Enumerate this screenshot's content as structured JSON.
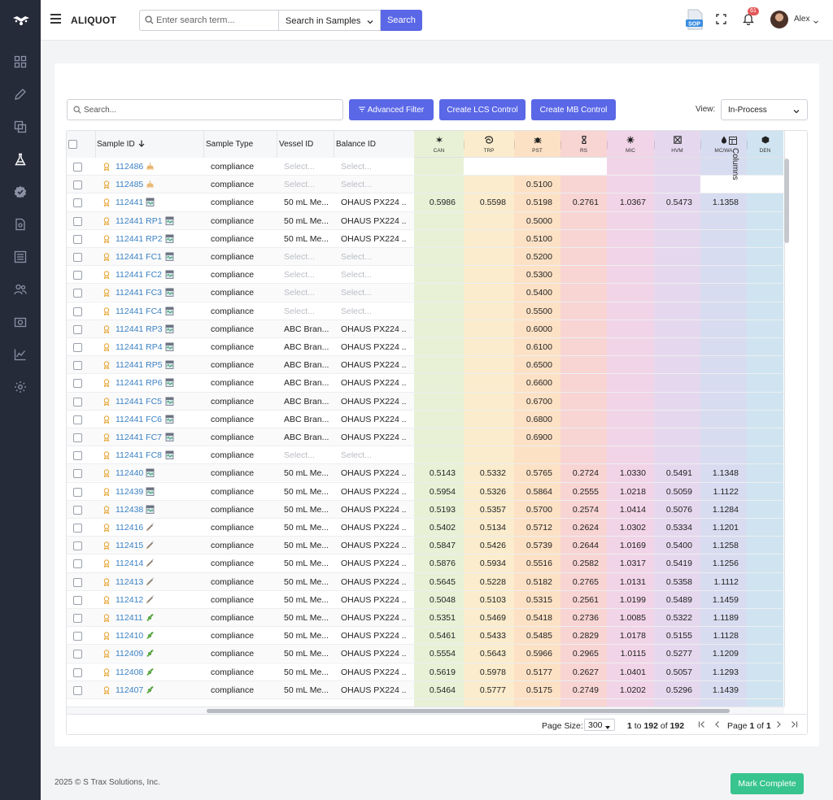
{
  "app": {
    "title": "ALIQUOT"
  },
  "search": {
    "placeholder": "Enter search term...",
    "scope": "Search in Samples",
    "button": "Search"
  },
  "header": {
    "notification_count": "61",
    "user_name": "Alex",
    "sop_label": "SOP"
  },
  "sidebar": {
    "items": [
      "dashboard-icon",
      "pencil-icon",
      "copy-icon",
      "flask-icon",
      "check-badge-icon",
      "document-icon",
      "list-icon",
      "users-icon",
      "camera-icon",
      "chart-icon",
      "settings-icon"
    ],
    "active": "flask-icon"
  },
  "toolbar": {
    "filter_placeholder": "Search...",
    "advanced_filter": "Advanced Filter",
    "create_lcs": "Create LCS Control",
    "create_mb": "Create MB Control",
    "view_label": "View:",
    "view_value": "In-Process"
  },
  "grid": {
    "columns": {
      "sample_id": "Sample ID",
      "sample_type": "Sample Type",
      "vessel_id": "Vessel ID",
      "balance_id": "Balance ID"
    },
    "analytes": [
      "CAN",
      "TRP",
      "PST",
      "RS",
      "MIC",
      "HVM",
      "MC/WA",
      "DEN"
    ],
    "select_placeholder": "Select...",
    "side_panel_label": "Columns",
    "rows": [
      {
        "id": "112486",
        "icon": "cake-icon",
        "type": "compliance",
        "vessel": "",
        "balance": "",
        "vals": [
          null,
          null,
          null,
          null,
          null,
          null,
          null,
          null
        ],
        "blank": [
          1,
          2,
          3
        ]
      },
      {
        "id": "112485",
        "icon": "cake-icon",
        "type": "compliance",
        "vessel": "",
        "balance": "",
        "vals": [
          null,
          null,
          "0.5100",
          null,
          null,
          null,
          null,
          null
        ],
        "blank": [
          6,
          7
        ]
      },
      {
        "id": "112441",
        "icon": "jar-icon",
        "type": "compliance",
        "vessel": "50 mL Me...",
        "balance": "OHAUS PX224 ...",
        "vals": [
          "0.5986",
          "0.5598",
          "0.5198",
          "0.2761",
          "1.0367",
          "0.5473",
          "1.1358",
          null
        ]
      },
      {
        "id": "112441 RP1",
        "icon": "jar-icon",
        "type": "compliance",
        "vessel": "50 mL Me...",
        "balance": "OHAUS PX224 ...",
        "vals": [
          null,
          null,
          "0.5000",
          null,
          null,
          null,
          null,
          null
        ]
      },
      {
        "id": "112441 RP2",
        "icon": "jar-icon",
        "type": "compliance",
        "vessel": "50 mL Me...",
        "balance": "OHAUS PX224 ...",
        "vals": [
          null,
          null,
          "0.5100",
          null,
          null,
          null,
          null,
          null
        ]
      },
      {
        "id": "112441 FC1",
        "icon": "jar-icon",
        "type": "compliance",
        "vessel": "",
        "balance": "",
        "vals": [
          null,
          null,
          "0.5200",
          null,
          null,
          null,
          null,
          null
        ]
      },
      {
        "id": "112441 FC2",
        "icon": "jar-icon",
        "type": "compliance",
        "vessel": "",
        "balance": "",
        "vals": [
          null,
          null,
          "0.5300",
          null,
          null,
          null,
          null,
          null
        ]
      },
      {
        "id": "112441 FC3",
        "icon": "jar-icon",
        "type": "compliance",
        "vessel": "",
        "balance": "",
        "vals": [
          null,
          null,
          "0.5400",
          null,
          null,
          null,
          null,
          null
        ]
      },
      {
        "id": "112441 FC4",
        "icon": "jar-icon",
        "type": "compliance",
        "vessel": "",
        "balance": "",
        "vals": [
          null,
          null,
          "0.5500",
          null,
          null,
          null,
          null,
          null
        ]
      },
      {
        "id": "112441 RP3",
        "icon": "jar-icon",
        "type": "compliance",
        "vessel": "ABC Bran...",
        "balance": "OHAUS PX224 ...",
        "vals": [
          null,
          null,
          "0.6000",
          null,
          null,
          null,
          null,
          null
        ]
      },
      {
        "id": "112441 RP4",
        "icon": "jar-icon",
        "type": "compliance",
        "vessel": "ABC Bran...",
        "balance": "OHAUS PX224 ...",
        "vals": [
          null,
          null,
          "0.6100",
          null,
          null,
          null,
          null,
          null
        ]
      },
      {
        "id": "112441 RP5",
        "icon": "jar-icon",
        "type": "compliance",
        "vessel": "ABC Bran...",
        "balance": "OHAUS PX224 ...",
        "vals": [
          null,
          null,
          "0.6500",
          null,
          null,
          null,
          null,
          null
        ]
      },
      {
        "id": "112441 RP6",
        "icon": "jar-icon",
        "type": "compliance",
        "vessel": "ABC Bran...",
        "balance": "OHAUS PX224 ...",
        "vals": [
          null,
          null,
          "0.6600",
          null,
          null,
          null,
          null,
          null
        ]
      },
      {
        "id": "112441 FC5",
        "icon": "jar-icon",
        "type": "compliance",
        "vessel": "ABC Bran...",
        "balance": "OHAUS PX224 ...",
        "vals": [
          null,
          null,
          "0.6700",
          null,
          null,
          null,
          null,
          null
        ]
      },
      {
        "id": "112441 FC6",
        "icon": "jar-icon",
        "type": "compliance",
        "vessel": "ABC Bran...",
        "balance": "OHAUS PX224 ...",
        "vals": [
          null,
          null,
          "0.6800",
          null,
          null,
          null,
          null,
          null
        ]
      },
      {
        "id": "112441 FC7",
        "icon": "jar-icon",
        "type": "compliance",
        "vessel": "ABC Bran...",
        "balance": "OHAUS PX224 ...",
        "vals": [
          null,
          null,
          "0.6900",
          null,
          null,
          null,
          null,
          null
        ]
      },
      {
        "id": "112441 FC8",
        "icon": "jar-icon",
        "type": "compliance",
        "vessel": "",
        "balance": "",
        "vals": [
          null,
          null,
          null,
          null,
          null,
          null,
          null,
          null
        ]
      },
      {
        "id": "112440",
        "icon": "jar-icon",
        "type": "compliance",
        "vessel": "50 mL Me...",
        "balance": "OHAUS PX224 ...",
        "vals": [
          "0.5143",
          "0.5332",
          "0.5765",
          "0.2724",
          "1.0330",
          "0.5491",
          "1.1348",
          null
        ]
      },
      {
        "id": "112439",
        "icon": "jar-icon",
        "type": "compliance",
        "vessel": "50 mL Me...",
        "balance": "OHAUS PX224 ...",
        "vals": [
          "0.5954",
          "0.5326",
          "0.5864",
          "0.2555",
          "1.0218",
          "0.5059",
          "1.1122",
          null
        ]
      },
      {
        "id": "112438",
        "icon": "jar-icon",
        "type": "compliance",
        "vessel": "50 mL Me...",
        "balance": "OHAUS PX224 ...",
        "vals": [
          "0.5193",
          "0.5357",
          "0.5700",
          "0.2574",
          "1.0414",
          "0.5076",
          "1.1284",
          null
        ]
      },
      {
        "id": "112416",
        "icon": "syringe-icon",
        "type": "compliance",
        "vessel": "50 mL Me...",
        "balance": "OHAUS PX224 ...",
        "vals": [
          "0.5402",
          "0.5134",
          "0.5712",
          "0.2624",
          "1.0302",
          "0.5334",
          "1.1201",
          null
        ]
      },
      {
        "id": "112415",
        "icon": "syringe-icon",
        "type": "compliance",
        "vessel": "50 mL Me...",
        "balance": "OHAUS PX224 ...",
        "vals": [
          "0.5847",
          "0.5426",
          "0.5739",
          "0.2644",
          "1.0169",
          "0.5400",
          "1.1258",
          null
        ]
      },
      {
        "id": "112414",
        "icon": "syringe-icon",
        "type": "compliance",
        "vessel": "50 mL Me...",
        "balance": "OHAUS PX224 ...",
        "vals": [
          "0.5876",
          "0.5934",
          "0.5516",
          "0.2582",
          "1.0317",
          "0.5419",
          "1.1256",
          null
        ]
      },
      {
        "id": "112413",
        "icon": "syringe-icon",
        "type": "compliance",
        "vessel": "50 mL Me...",
        "balance": "OHAUS PX224 ...",
        "vals": [
          "0.5645",
          "0.5228",
          "0.5182",
          "0.2765",
          "1.0131",
          "0.5358",
          "1.1112",
          null
        ]
      },
      {
        "id": "112412",
        "icon": "syringe-icon",
        "type": "compliance",
        "vessel": "50 mL Me...",
        "balance": "OHAUS PX224 ...",
        "vals": [
          "0.5048",
          "0.5103",
          "0.5315",
          "0.2561",
          "1.0199",
          "0.5489",
          "1.1459",
          null
        ]
      },
      {
        "id": "112411",
        "icon": "pre-roll-icon",
        "type": "compliance",
        "vessel": "50 mL Me...",
        "balance": "OHAUS PX224 ...",
        "vals": [
          "0.5351",
          "0.5469",
          "0.5418",
          "0.2736",
          "1.0085",
          "0.5322",
          "1.1189",
          null
        ]
      },
      {
        "id": "112410",
        "icon": "pre-roll-icon",
        "type": "compliance",
        "vessel": "50 mL Me...",
        "balance": "OHAUS PX224 ...",
        "vals": [
          "0.5461",
          "0.5433",
          "0.5485",
          "0.2829",
          "1.0178",
          "0.5155",
          "1.1128",
          null
        ]
      },
      {
        "id": "112409",
        "icon": "pre-roll-icon",
        "type": "compliance",
        "vessel": "50 mL Me...",
        "balance": "OHAUS PX224 ...",
        "vals": [
          "0.5554",
          "0.5643",
          "0.5966",
          "0.2965",
          "1.0115",
          "0.5277",
          "1.1209",
          null
        ]
      },
      {
        "id": "112408",
        "icon": "pre-roll-icon",
        "type": "compliance",
        "vessel": "50 mL Me...",
        "balance": "OHAUS PX224 ...",
        "vals": [
          "0.5619",
          "0.5978",
          "0.5177",
          "0.2627",
          "1.0401",
          "0.5057",
          "1.1293",
          null
        ]
      },
      {
        "id": "112407",
        "icon": "pre-roll-icon",
        "type": "compliance",
        "vessel": "50 mL Me...",
        "balance": "OHAUS PX224 ...",
        "vals": [
          "0.5464",
          "0.5777",
          "0.5175",
          "0.2749",
          "1.0202",
          "0.5296",
          "1.1439",
          null
        ]
      }
    ]
  },
  "pagination": {
    "page_size_label": "Page Size:",
    "page_size": "300",
    "range_from": "1",
    "range_to_word": "to",
    "range_to": "192",
    "of_word": "of",
    "total": "192",
    "page_word": "Page",
    "page": "1",
    "page_of": "of",
    "page_total": "1"
  },
  "footer": {
    "copyright": "2025 © S Trax Solutions, Inc.",
    "mark_complete": "Mark Complete"
  }
}
